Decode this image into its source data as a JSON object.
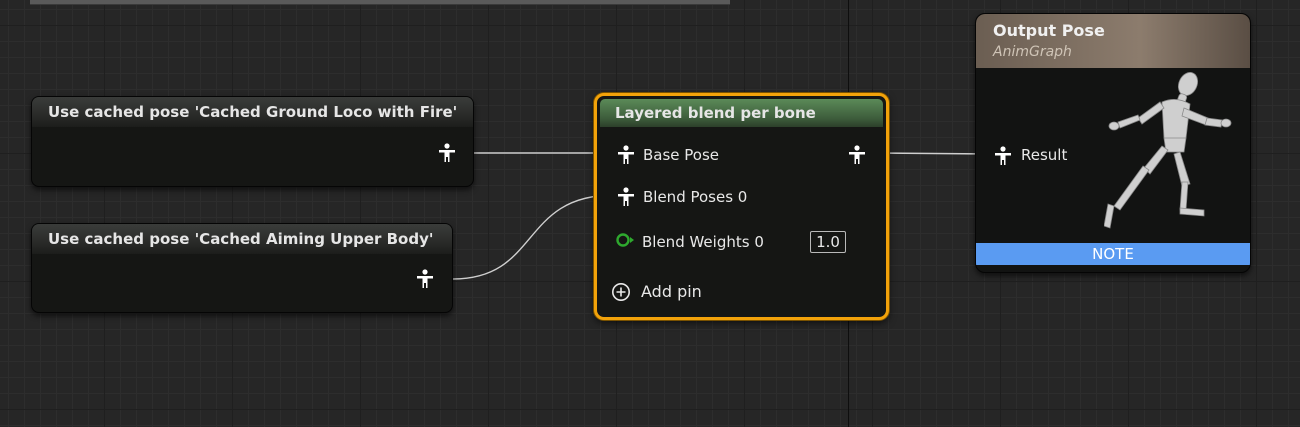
{
  "graph": {
    "nodes": {
      "cached_ground": {
        "title": "Use cached pose 'Cached Ground Loco with Fire'"
      },
      "cached_aiming": {
        "title": "Use cached pose 'Cached Aiming Upper Body'"
      },
      "layered_blend": {
        "title": "Layered blend per bone",
        "pins": {
          "base_pose": "Base Pose",
          "blend_poses": "Blend Poses 0",
          "blend_weights": "Blend Weights 0",
          "blend_weights_value": "1.0",
          "add_pin": "Add pin"
        }
      },
      "output_pose": {
        "title": "Output Pose",
        "subtitle": "AnimGraph",
        "result_pin": "Result",
        "note": "NOTE"
      }
    },
    "colors": {
      "selection_outline": "#f2a20a",
      "blend_header": "#4f7a4c",
      "note_bar": "#5a9bf2",
      "float_pin": "#2ea82e",
      "wire": "#cfcfcf"
    },
    "icons": {
      "pose_pin": "pose-person-icon",
      "float_pin": "float-pin-icon",
      "add_pin": "plus-circle-icon",
      "preview": "mannequin-running-icon"
    }
  }
}
